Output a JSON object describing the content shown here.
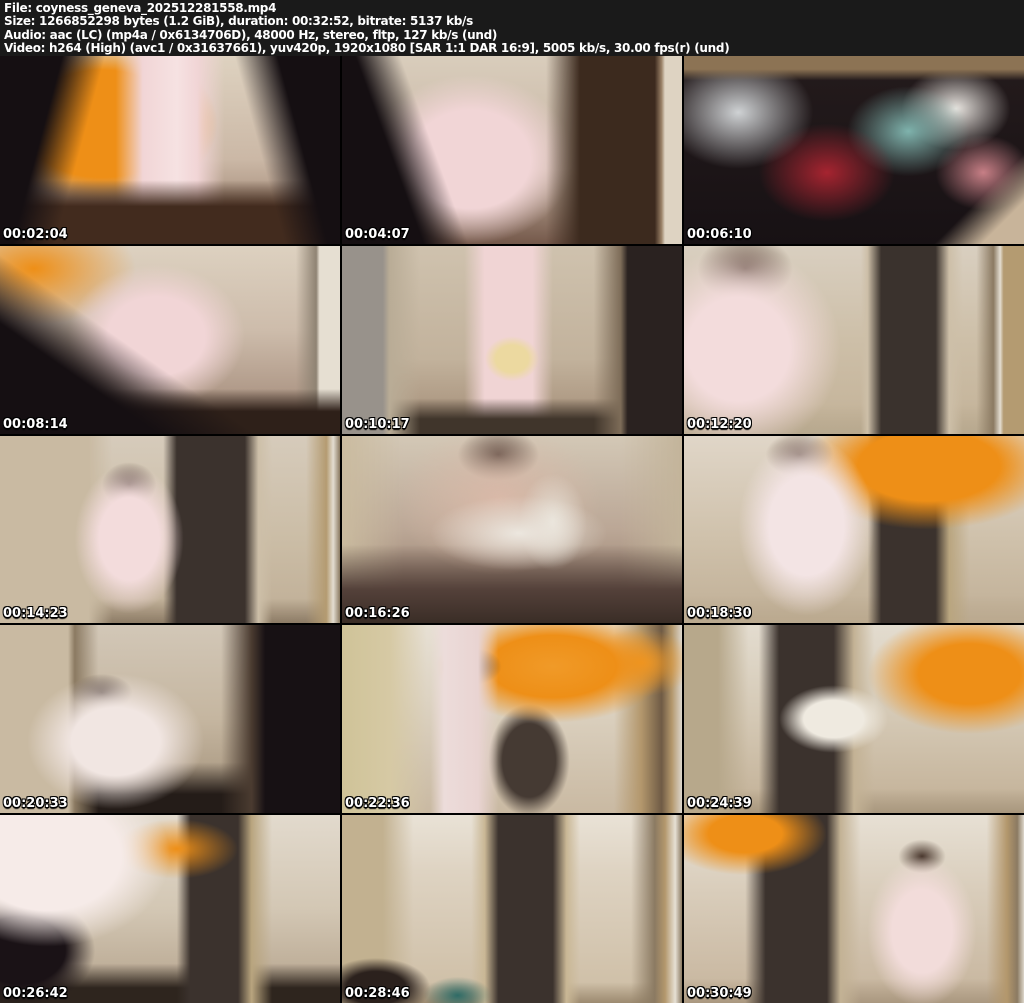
{
  "header": {
    "lines": [
      "File: coyness_geneva_202512281558.mp4",
      "Size: 1266852298 bytes (1.2 GiB), duration: 00:32:52, bitrate: 5137 kb/s",
      "Audio: aac (LC) (mp4a / 0x6134706D), 48000 Hz, stereo, fltp, 127 kb/s (und)",
      "Video: h264 (High) (avc1 / 0x31637661), yuv420p, 1920x1080 [SAR 1:1 DAR 16:9], 5005 kb/s, 30.00 fps(r) (und)"
    ]
  },
  "colors": {
    "header_bg": "#1a1a1a",
    "header_text": "#ffffff",
    "grid_gap": "#000000",
    "timestamp_text": "#ffffff",
    "accent_orange": "#ee8f17",
    "accent_pink": "#f1d5d6",
    "room_beige": "#cdbfa8",
    "door_brown": "#3b322d",
    "shadow_dark": "#150f12"
  },
  "grid": {
    "columns": 3,
    "rows": 5,
    "thumbnails": [
      {
        "timestamp": "00:02:04",
        "style": "background-color:#c4ae9e;background-image:linear-gradient(105deg,#150f12 0%,#150f12 16%,rgba(21,15,18,0) 27%),linear-gradient(255deg,#150f12 0%,#150f12 16%,rgba(21,15,18,0) 27%),linear-gradient(0deg,#422b1e 0%,#422b1e 20%,rgba(66,43,30,0) 34%),linear-gradient(90deg,rgba(241,213,214,0) 34%,#f1d5d6 42%,#f6e2e2 52%,#f1d5d6 58%,rgba(241,213,214,0) 66%),radial-gradient(ellipse 34% 42% at 30% 36%,#ee8f17 0%,#ee8f17 68%,rgba(238,143,23,0) 100%),linear-gradient(180deg,#ded2c0 0%,#cbb8a6 55%,#8a6e5c 100%)"
      },
      {
        "timestamp": "00:04:07",
        "style": "background-color:#cdbfae;background-image:linear-gradient(70deg,#150f12 0%,#150f12 20%,rgba(21,15,18,0) 31%),linear-gradient(270deg,#ded3c2 0%,#ded3c2 5%,#9b8268 6%,#3c2a1e 8%,#3c2a1e 30%,rgba(60,42,30,0) 40%),radial-gradient(ellipse 30% 45% at 38% 55%,#f1d5d6 0%,#f1d5d6 58%,rgba(241,213,214,0) 100%),linear-gradient(180deg,#d9cdbc 0%,#c6b4a2 60%,#74584a 100%)"
      },
      {
        "timestamp": "00:06:10",
        "style": "background-color:#171114;background-image:linear-gradient(180deg,#8c7354 0%,#8c7354 7%,rgba(140,115,84,0) 13%),linear-gradient(315deg,#c8b49a 0%,#c8b49a 8%,rgba(200,180,154,0) 17%),radial-gradient(ellipse 22% 30% at 16% 30%,#cfd2d4 0%,rgba(207,210,212,0) 100%),radial-gradient(ellipse 20% 26% at 42% 62%,#a62430 0%,rgba(166,36,48,0) 100%),radial-gradient(ellipse 18% 24% at 66% 40%,#7fb3ad 0%,rgba(127,179,173,0) 100%),radial-gradient(ellipse 16% 22% at 80% 28%,#e8e4df 0%,rgba(232,228,223,0) 100%),radial-gradient(ellipse 14% 20% at 88% 62%,#c77f86 0%,rgba(199,127,134,0) 100%),linear-gradient(180deg,#241b1c 0%,#171114 100%)"
      },
      {
        "timestamp": "00:08:14",
        "style": "background-color:#cdbcab;background-image:linear-gradient(35deg,#150f12 0%,#150f12 26%,rgba(21,15,18,0) 42%),linear-gradient(0deg,#2e2019 0%,#2e2019 12%,rgba(46,32,25,0) 24%),linear-gradient(270deg,#e6dfd2 0%,#e6dfd2 6%,#8f8373 7%,rgba(143,131,115,0) 13%),radial-gradient(ellipse 26% 38% at 46% 48%,#f1d5d6 0%,#f1d5d6 55%,rgba(241,213,214,0) 100%),radial-gradient(ellipse 30% 30% at 10% 12%,#ee8f17 0%,rgba(238,143,23,0) 100%),linear-gradient(180deg,#ddd1c0 0%,#cdbcab 45%,#9c8271 100%)"
      },
      {
        "timestamp": "00:10:17",
        "style": "background-color:#c2b29c;background-image:linear-gradient(90deg,#98928b 0%,#98928b 12%,#b9ac96 14%,rgba(185,172,150,0) 23%),linear-gradient(270deg,#2a2220 0%,#2a2220 16%,#7d6c58 18%,rgba(125,108,88,0) 26%),linear-gradient(0deg,#40352b 0%,#40352b 8%,rgba(64,53,43,0) 19%),radial-gradient(ellipse 8% 12% at 50% 60%,#ecd9a0 0%,#ecd9a0 60%,rgba(236,217,160,0) 100%),linear-gradient(90deg,rgba(240,212,212,0) 36%,#f0d4d4 42%,#f0d4d4 56%,rgba(240,212,212,0) 62%),linear-gradient(180deg,#cfc2ae 0%,#c2b29c 60%,#a18a74 100%)"
      },
      {
        "timestamp": "00:12:20",
        "style": "background-color:#c7b9a4;background-image:radial-gradient(ellipse 30% 55% at 16% 55%,#f3dcdc 0%,#f3dcdc 50%,rgba(243,220,220,0) 100%),radial-gradient(ellipse 14% 18% at 18% 12%,#5f4a3d 0%,rgba(95,74,61,0) 100%),linear-gradient(90deg,rgba(0,0,0,0) 52%,#cdbfa8 54%,#3a322d 58%,#3a322d 74%,#cdbfa8 78%,rgba(205,191,168,0) 82%),linear-gradient(270deg,#b49b71 0%,#b49b71 6%,#e3ddd1 7%,#8b7a62 9%,rgba(139,122,98,0) 14%),linear-gradient(0deg,#b7a88e 0%,rgba(183,168,142,0) 16%),linear-gradient(180deg,#d9cfc0 0%,#cdbfa8 50%,#c3b298 100%)"
      },
      {
        "timestamp": "00:14:23",
        "style": "background-color:#cbbda6;background-image:radial-gradient(ellipse 16% 40% at 38% 55%,#f3dcdc 0%,#f3dcdc 55%,rgba(243,220,220,0) 100%),radial-gradient(ellipse 8% 12% at 38% 26%,#4a3a30 0%,rgba(74,58,48,0) 100%),linear-gradient(90deg,#c9baa2 0%,#c9baa2 26%,rgba(201,186,162,0) 33%),linear-gradient(90deg,rgba(0,0,0,0) 48%,#3b322d 52%,#3b322d 72%,#cdbfa8 76%,rgba(205,191,168,0) 80%),linear-gradient(270deg,#8b7a62 0%,#e3ddd1 2%,#b49b71 4%,rgba(180,155,113,0) 10%),linear-gradient(0deg,#8d7c66 0%,rgba(141,124,102,0) 13%),linear-gradient(180deg,#d6cbbb 0%,#cbbda6 55%,#bfae96 100%)"
      },
      {
        "timestamp": "00:16:26",
        "style": "background-color:#bba796;background-image:radial-gradient(ellipse 26% 20% at 52% 52%,#ece7df 0%,rgba(236,231,223,0) 100%),radial-gradient(ellipse 10% 26% at 62% 46%,#e9e4da 0%,rgba(233,228,218,0) 100%),radial-gradient(ellipse 30% 40% at 46% 34%,#d9b9a8 0%,rgba(217,185,168,0) 100%),radial-gradient(ellipse 12% 14% at 46% 10%,#43332b 0%,rgba(67,51,43,0) 100%),linear-gradient(0deg,#3a2d26 0%,#54413a 18%,rgba(84,65,58,0) 42%),linear-gradient(90deg,#cabb9f 0%,rgba(202,187,159,0) 18%),linear-gradient(270deg,#c3b49a 0%,rgba(195,180,154,0) 18%),linear-gradient(180deg,#d3c8b6 0%,#bba796 50%,#8a7261 100%)"
      },
      {
        "timestamp": "00:18:30",
        "style": "background-color:#cfc1ab;background-image:radial-gradient(ellipse 20% 48% at 36% 48%,#f3e4e4 0%,#f3e4e4 55%,rgba(243,228,228,0) 100%),radial-gradient(ellipse 10% 12% at 34% 10%,#6b564a 0%,rgba(107,86,74,0) 100%),radial-gradient(ellipse 38% 34% at 72% 16%,#ee8f17 0%,#ee8f17 55%,rgba(238,143,23,0) 100%),linear-gradient(90deg,rgba(0,0,0,0) 54%,#3b322d 58%,#3b322d 74%,#b9a57f 78%,rgba(185,165,127,0) 84%),linear-gradient(0deg,#baa98f 0%,rgba(186,169,143,0) 15%),linear-gradient(180deg,#e0d6c8 0%,#cfc1ab 55%,#c0af96 100%)"
      },
      {
        "timestamp": "00:20:33",
        "style": "background-color:#c5b6a0;background-image:radial-gradient(ellipse 26% 36% at 34% 62%,#f1e6e2 0%,#f1e6e2 50%,rgba(241,230,226,0) 100%),radial-gradient(ellipse 9% 10% at 30% 36%,#43332b 0%,rgba(67,51,43,0) 100%),linear-gradient(90deg,#c9baa2 0%,#c9baa2 20%,#8b7a62 22%,rgba(139,122,98,0) 29%),linear-gradient(270deg,#171114 0%,#171114 22%,#4a3b30 26%,rgba(74,59,48,0) 35%),linear-gradient(0deg,#241c18 0%,#241c18 10%,rgba(36,28,24,0) 27%),linear-gradient(180deg,#d2c7b7 0%,#c5b6a0 50%,#9f8d76 100%)"
      },
      {
        "timestamp": "00:22:36",
        "style": "background-color:#ddd3c2;background-image:linear-gradient(90deg,rgba(0,0,0,0) 26%,#ecdcda 30%,#e9d4d2 40%,rgba(233,212,210,0) 46%),radial-gradient(ellipse 9% 10% at 38% 22%,#4a382e 0%,rgba(74,56,46,0) 100%),radial-gradient(ellipse 34% 30% at 62% 22%,#f09a28 0%,#ee8f17 55%,rgba(238,143,23,0) 100%),radial-gradient(ellipse 16% 18% at 88% 20%,#f09a28 0%,rgba(240,154,40,0) 100%),radial-gradient(ellipse 12% 30% at 55% 72%,#453a33 0%,#453a33 65%,rgba(69,58,51,0) 100%),linear-gradient(270deg,#dcd6cc 0%,#b3976c 3%,#6f5b45 6%,#b3976c 12%,rgba(179,151,108,0) 20%),linear-gradient(90deg,#cfc398 0%,#d6c9a4 14%,rgba(214,201,164,0) 25%),linear-gradient(180deg,#e7e0d4 0%,#ddd3c2 40%,#c9b9a2 100%)"
      },
      {
        "timestamp": "00:24:39",
        "style": "background-color:#d4c8b4;background-image:radial-gradient(ellipse 16% 18% at 44% 50%,#efeae0 0%,#efeae0 55%,rgba(239,234,224,0) 100%),radial-gradient(ellipse 30% 32% at 84% 26%,#ee8f17 0%,#ee8f17 50%,rgba(238,143,23,0) 100%),linear-gradient(90deg,rgba(0,0,0,0) 22%,#3b322d 28%,#3b322d 44%,#c3b295 50%,rgba(195,178,149,0) 56%),linear-gradient(90deg,#b7a88b 0%,#b7a88b 10%,rgba(183,168,139,0) 19%),linear-gradient(0deg,#a8977e 0%,rgba(168,151,126,0) 13%),linear-gradient(180deg,#e3dccf 0%,#d4c8b4 50%,#c2b096 100%)"
      },
      {
        "timestamp": "00:26:42",
        "style": "background-color:#d3c7b4;background-image:radial-gradient(ellipse 36% 48% at 14% 22%,#f6ebe8 0%,#f6ebe8 60%,rgba(246,235,232,0) 100%),radial-gradient(ellipse 22% 30% at 6% 72%,#1a1216 0%,#1a1216 60%,rgba(26,18,22,0) 100%),radial-gradient(ellipse 18% 16% at 52% 18%,#ee8f17 0%,rgba(238,143,23,0) 100%),linear-gradient(90deg,rgba(0,0,0,0) 52%,#3b322d 56%,#3b322d 70%,#b9a57f 74%,rgba(185,165,127,0) 80%),linear-gradient(0deg,#2e251e 0%,#2e251e 8%,rgba(46,37,30,0) 21%),linear-gradient(180deg,#e2dacd 0%,#d3c7b4 50%,#b2a089 100%)"
      },
      {
        "timestamp": "00:28:46",
        "style": "background-color:#ded3c2;background-image:radial-gradient(ellipse 16% 16% at 10% 92%,#2b211d 0%,#2b211d 55%,rgba(43,33,29,0) 100%),radial-gradient(ellipse 10% 10% at 34% 96%,#2e6b66 0%,rgba(46,107,102,0) 100%),linear-gradient(90deg,rgba(0,0,0,0) 38%,#c9b795 42%,#3b322d 46%,#3b322d 62%,#c9b795 66%,rgba(201,183,149,0) 70%),linear-gradient(270deg,#8b7a62 0%,#e6e0d4 2%,#b3976c 5%,#8b7a62 8%,rgba(139,122,98,0) 15%),linear-gradient(90deg,#c2b190 0%,#c2b190 12%,rgba(194,177,144,0) 21%),linear-gradient(0deg,#9c8a70 0%,rgba(156,138,112,0) 11%),linear-gradient(180deg,#e9e2d6 0%,#ded3c2 30%,#cdbda4 100%)"
      },
      {
        "timestamp": "00:30:49",
        "style": "background-color:#d9cdbb;background-image:radial-gradient(ellipse 16% 40% at 70% 62%,#f2dcda 0%,#f2dcda 55%,rgba(242,220,218,0) 100%),radial-gradient(ellipse 7% 9% at 70% 22%,#4a382e 0%,rgba(74,56,46,0) 100%),radial-gradient(ellipse 24% 22% at 18% 10%,#ee8f17 0%,#ee8f17 45%,rgba(238,143,23,0) 100%),linear-gradient(90deg,rgba(0,0,0,0) 18%,#3b322d 24%,#3b322d 42%,#c3b295 46%,rgba(195,178,149,0) 52%),linear-gradient(270deg,#ddd7cb 0%,#8b7a62 2%,#b3976c 5%,rgba(179,151,108,0) 11%),linear-gradient(0deg,#aa9880 0%,rgba(170,152,128,0) 13%),linear-gradient(180deg,#e7e0d4 0%,#d9cdbb 40%,#c6b49c 100%)"
      }
    ]
  }
}
